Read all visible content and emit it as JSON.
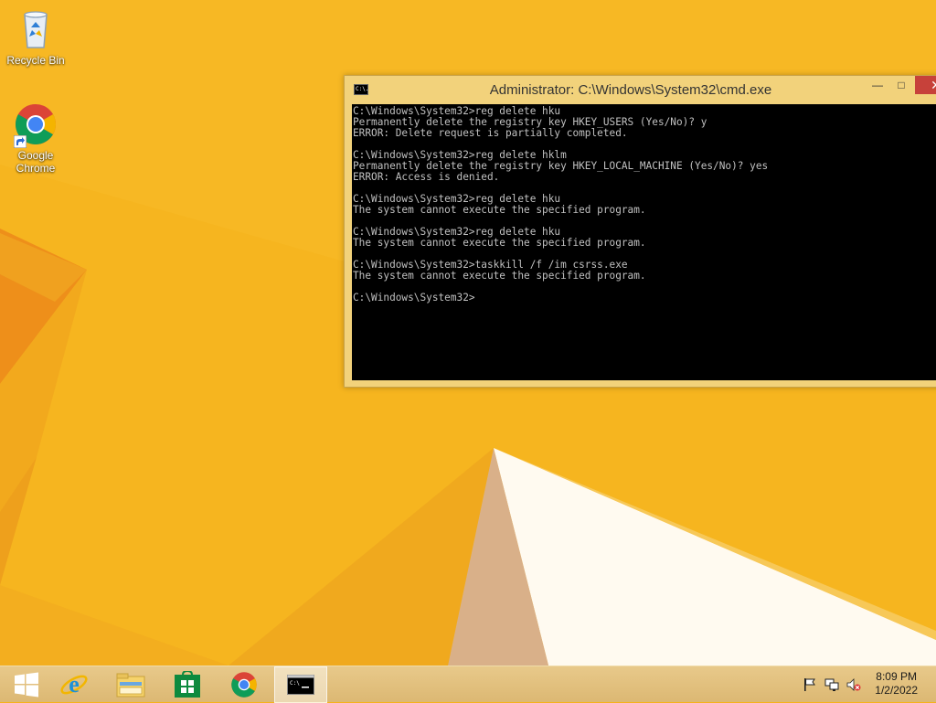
{
  "desktop": {
    "icons": [
      {
        "label": "Recycle Bin",
        "icon": "recycle-bin-icon"
      },
      {
        "label": "Google\nChrome",
        "icon": "chrome-icon"
      }
    ]
  },
  "cmd": {
    "title": "Administrator: C:\\Windows\\System32\\cmd.exe",
    "icon_text": "C:\\.",
    "minimize": "—",
    "maximize": "□",
    "close": "✕",
    "lines": [
      "C:\\Windows\\System32>reg delete hku",
      "Permanently delete the registry key HKEY_USERS (Yes/No)? y",
      "ERROR: Delete request is partially completed.",
      "",
      "C:\\Windows\\System32>reg delete hklm",
      "Permanently delete the registry key HKEY_LOCAL_MACHINE (Yes/No)? yes",
      "ERROR: Access is denied.",
      "",
      "C:\\Windows\\System32>reg delete hku",
      "The system cannot execute the specified program.",
      "",
      "C:\\Windows\\System32>reg delete hku",
      "The system cannot execute the specified program.",
      "",
      "C:\\Windows\\System32>taskkill /f /im csrss.exe",
      "The system cannot execute the specified program.",
      "",
      "C:\\Windows\\System32>"
    ]
  },
  "taskbar": {
    "items": [
      "start-button",
      "internet-explorer",
      "file-explorer",
      "store",
      "chrome",
      "command-prompt"
    ],
    "clock": {
      "time": "8:09 PM",
      "date": "1/2/2022"
    }
  },
  "colors": {
    "background": "#f5b21c",
    "window_frame": "#f2d27b",
    "close_button": "#c7413a"
  }
}
